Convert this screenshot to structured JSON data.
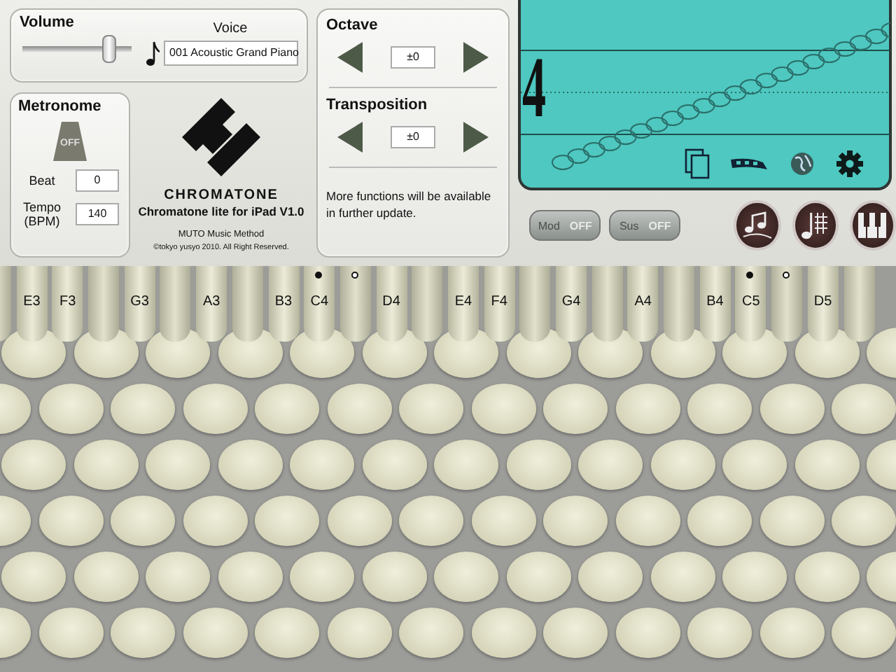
{
  "volume": {
    "label": "Volume",
    "level": 0.8
  },
  "voice": {
    "label": "Voice",
    "value": "001 Acoustic Grand Piano"
  },
  "metronome": {
    "title": "Metronome",
    "indicator": "OFF",
    "beat_label": "Beat",
    "beat": "0",
    "tempo_label": "Tempo (BPM)",
    "tempo": "140"
  },
  "logo": {
    "wordmark": "CHROMATONE",
    "title": "Chromatone lite for iPad V1.0",
    "credit": "MUTO Music Method",
    "copyright": "©tokyo yusyo 2010. All Right Reserved."
  },
  "octave": {
    "label": "Octave",
    "value": "±0"
  },
  "transposition": {
    "label": "Transposition",
    "value": "±0"
  },
  "note": "More functions will be available in further update.",
  "display": {
    "octave_number": "4"
  },
  "toggles": [
    {
      "label": "Mod",
      "value": "OFF",
      "on": false
    },
    {
      "label": "Sus",
      "value": "OFF",
      "on": false
    }
  ],
  "keyboard": {
    "columns": [
      {
        "kind": "sharp"
      },
      {
        "kind": "natural",
        "label": "E3"
      },
      {
        "kind": "natural",
        "label": "F3"
      },
      {
        "kind": "sharp"
      },
      {
        "kind": "natural",
        "label": "G3"
      },
      {
        "kind": "sharp"
      },
      {
        "kind": "natural",
        "label": "A3"
      },
      {
        "kind": "sharp"
      },
      {
        "kind": "natural",
        "label": "B3"
      },
      {
        "kind": "natural",
        "label": "C4",
        "dot_filled": true
      },
      {
        "kind": "sharp",
        "dot_filled": false
      },
      {
        "kind": "natural",
        "label": "D4"
      },
      {
        "kind": "sharp"
      },
      {
        "kind": "natural",
        "label": "E4"
      },
      {
        "kind": "natural",
        "label": "F4"
      },
      {
        "kind": "sharp"
      },
      {
        "kind": "natural",
        "label": "G4"
      },
      {
        "kind": "sharp"
      },
      {
        "kind": "natural",
        "label": "A4"
      },
      {
        "kind": "sharp"
      },
      {
        "kind": "natural",
        "label": "B4"
      },
      {
        "kind": "natural",
        "label": "C5",
        "dot_filled": true
      },
      {
        "kind": "sharp",
        "dot_filled": false
      },
      {
        "kind": "natural",
        "label": "D5"
      },
      {
        "kind": "sharp"
      }
    ]
  }
}
